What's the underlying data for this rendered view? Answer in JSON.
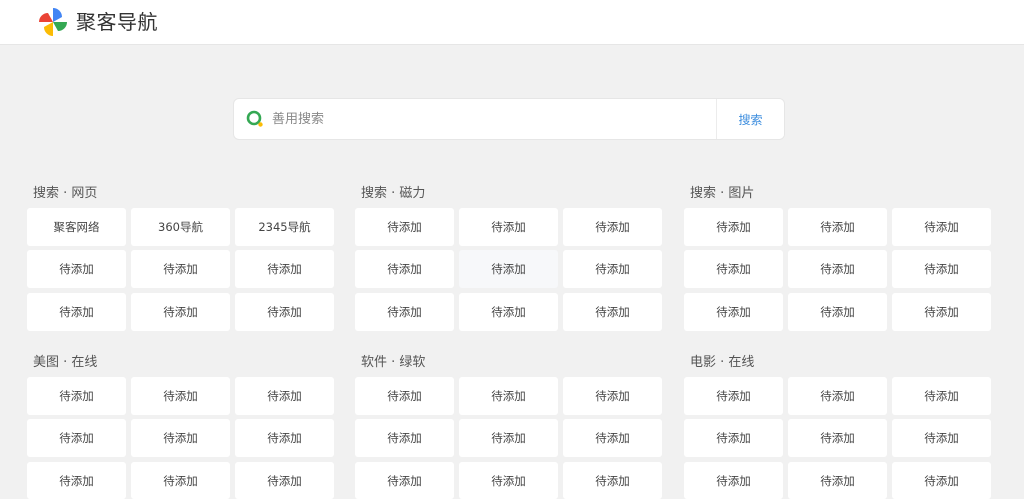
{
  "header": {
    "site_name": "聚客导航",
    "logo_colors": [
      "#4285f4",
      "#ea4335",
      "#fbbc05",
      "#34a853"
    ]
  },
  "search": {
    "placeholder": "善用搜索",
    "value": "",
    "button_label": "搜索",
    "icon": "search-icon",
    "icon_colors": [
      "#34a853",
      "#fbbc05"
    ],
    "button_color": "#3c8dde"
  },
  "sections": [
    {
      "title": "搜索 · 网页",
      "links": [
        "聚客网络",
        "360导航",
        "2345导航",
        "待添加",
        "待添加",
        "待添加",
        "待添加",
        "待添加",
        "待添加"
      ]
    },
    {
      "title": "搜索 · 磁力",
      "links": [
        "待添加",
        "待添加",
        "待添加",
        "待添加",
        "待添加",
        "待添加",
        "待添加",
        "待添加",
        "待添加"
      ]
    },
    {
      "title": "搜索 · 图片",
      "links": [
        "待添加",
        "待添加",
        "待添加",
        "待添加",
        "待添加",
        "待添加",
        "待添加",
        "待添加",
        "待添加"
      ]
    },
    {
      "title": "美图 · 在线",
      "links": [
        "待添加",
        "待添加",
        "待添加",
        "待添加",
        "待添加",
        "待添加",
        "待添加",
        "待添加",
        "待添加"
      ]
    },
    {
      "title": "软件 · 绿软",
      "links": [
        "待添加",
        "待添加",
        "待添加",
        "待添加",
        "待添加",
        "待添加",
        "待添加",
        "待添加",
        "待添加"
      ]
    },
    {
      "title": "电影 · 在线",
      "links": [
        "待添加",
        "待添加",
        "待添加",
        "待添加",
        "待添加",
        "待添加",
        "待添加",
        "待添加",
        "待添加"
      ]
    }
  ]
}
